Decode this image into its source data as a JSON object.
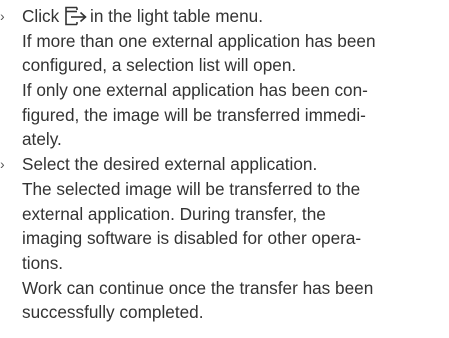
{
  "steps": [
    {
      "marker": "›",
      "text_before_icon": "Click",
      "icon": "transfer-to-external-app-icon",
      "text_after_icon": "in the light table menu.",
      "result_lines": [
        "If more than one external application has been",
        "configured, a selection list will open.",
        "If only one external application has been con-",
        "figured, the image will be transferred immedi-",
        "ately."
      ]
    },
    {
      "marker": "›",
      "instruction": "Select the desired external application.",
      "result_lines": [
        "The selected image will be transferred to the",
        "external application. During transfer, the",
        "imaging software is disabled for other opera-",
        "tions.",
        "Work can continue once the transfer has been",
        "successfully completed."
      ]
    }
  ]
}
